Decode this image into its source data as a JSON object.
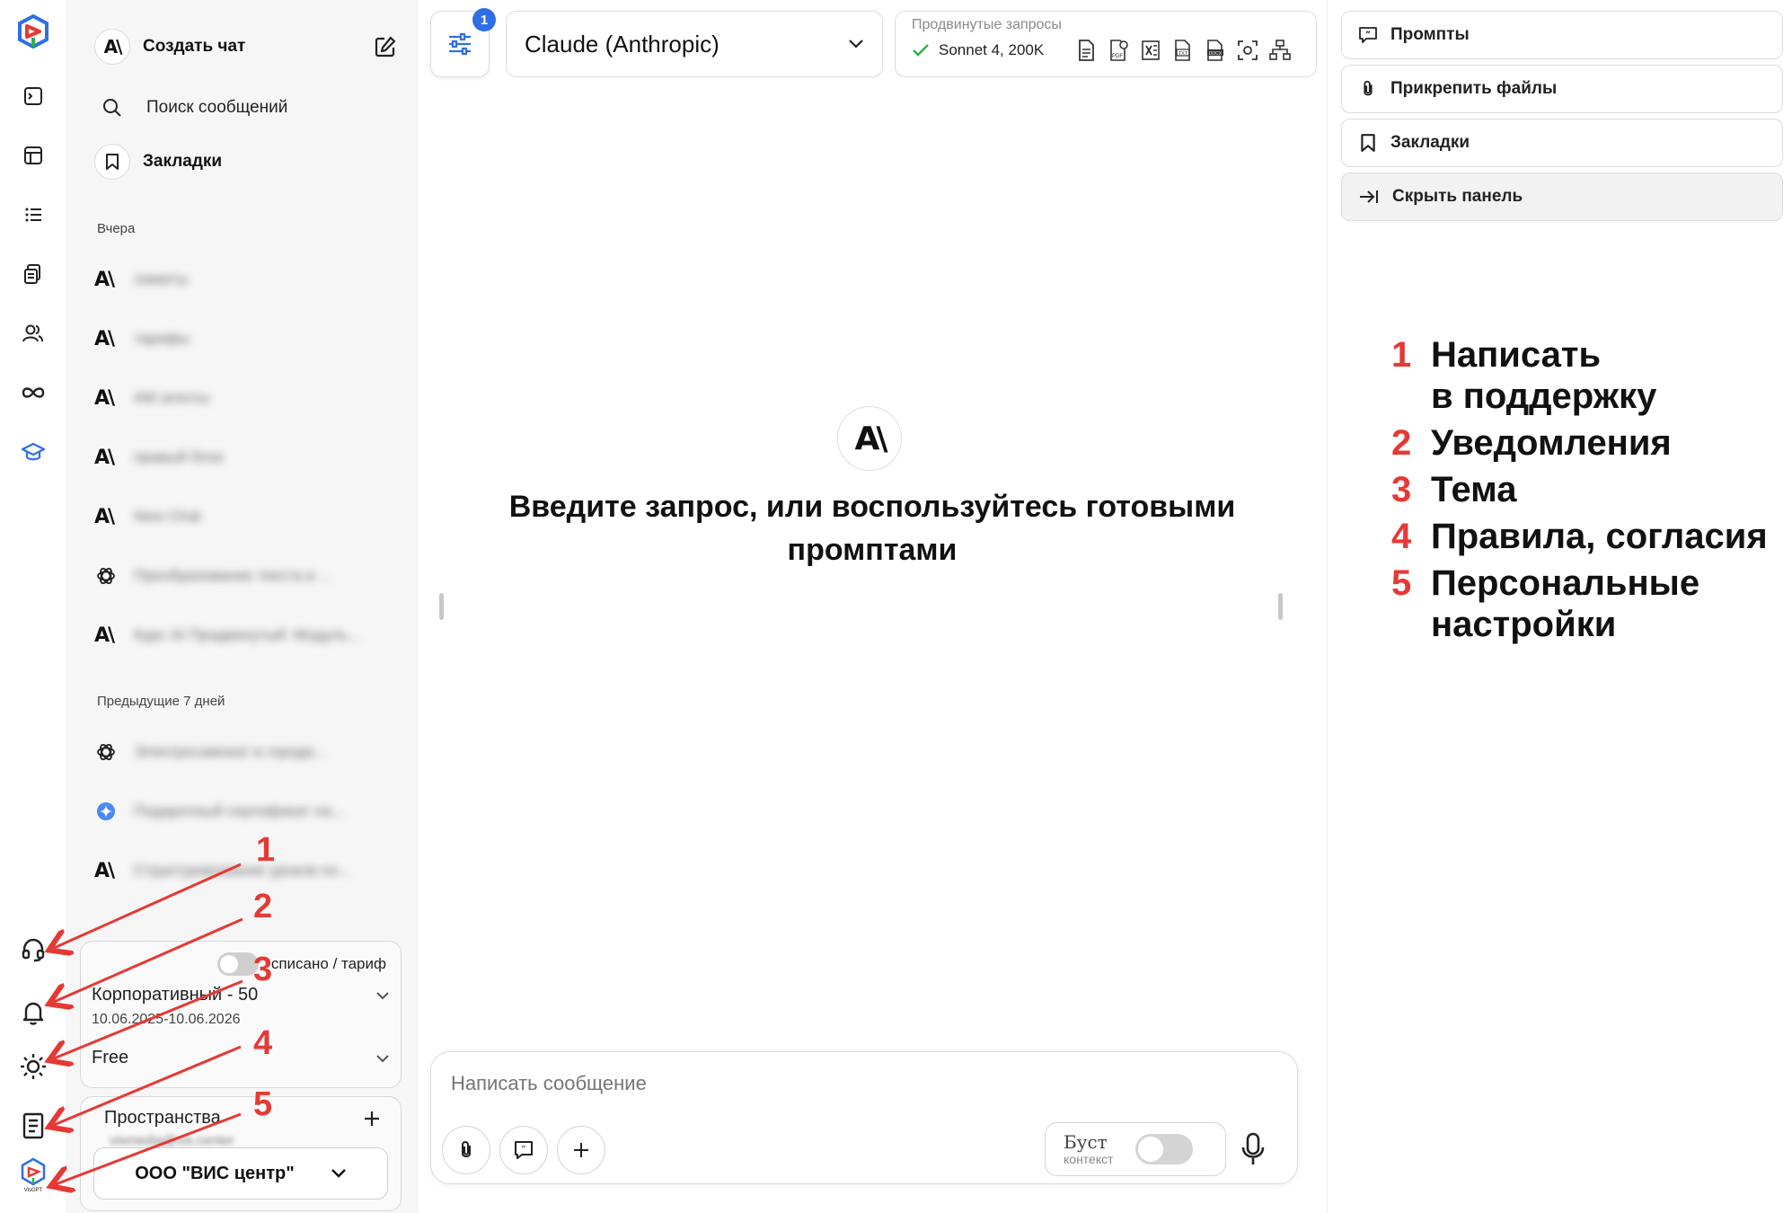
{
  "sidebar": {
    "new_chat_label": "Создать чат",
    "search_label": "Поиск сообщений",
    "bookmarks_label": "Закладки",
    "section_yesterday": "Вчера",
    "section_prev7": "Предыдущие 7 дней",
    "chats_yesterday": [
      {
        "icon": "anthropic-icon",
        "title": "лимиты"
      },
      {
        "icon": "anthropic-icon",
        "title": "тарифы"
      },
      {
        "icon": "anthropic-icon",
        "title": "AM агенты"
      },
      {
        "icon": "anthropic-icon",
        "title": "правый блок"
      },
      {
        "icon": "anthropic-icon",
        "title": "New Chat"
      },
      {
        "icon": "openai-icon",
        "title": "Преобразование текста в ..."
      },
      {
        "icon": "anthropic-icon",
        "title": "Курс AI Продвинутый: Модуль..."
      }
    ],
    "chats_prev7": [
      {
        "icon": "openai-icon",
        "title": "Электросамокат в городе..."
      },
      {
        "icon": "gemini-icon",
        "title": "Подарочный сертификат на..."
      },
      {
        "icon": "anthropic-icon",
        "title": "Структурирование уроков по..."
      }
    ],
    "billing_toggle_label": "списано / тариф",
    "tariff_name": "Корпоративный - 50",
    "tariff_dates": "10.06.2025-10.06.2026",
    "free_label": "Free",
    "spaces_label": "Пространства",
    "spaces_email": "vismedia@vis.center",
    "org_name": "ООО \"ВИС центр\""
  },
  "main": {
    "settings_badge": "1",
    "model_name": "Claude (Anthropic)",
    "advanced_label": "Продвинутые запросы",
    "advanced_model": "Sonnet 4, 200K",
    "hero_text": "Введите запрос, или воспользуйтесь готовыми промптами",
    "composer_placeholder": "Написать сообщение",
    "boost_title": "Буст",
    "boost_sub": "контекст"
  },
  "right_panel": {
    "buttons": [
      "Промпты",
      "Прикрепить файлы",
      "Закладки",
      "Скрыть панель"
    ]
  },
  "annotations": {
    "color": "#e53935",
    "items": [
      {
        "num": "1",
        "text": "Написать\nв поддержку"
      },
      {
        "num": "2",
        "text": "Уведомления"
      },
      {
        "num": "3",
        "text": "Тема"
      },
      {
        "num": "4",
        "text": "Правила, согласия"
      },
      {
        "num": "5",
        "text": "Персональные\nнастройки"
      }
    ]
  },
  "icons": {
    "rail_top": [
      "app-logo-icon",
      "terminal-icon",
      "table-icon",
      "list-icon",
      "documents-icon",
      "users-icon",
      "infinity-icon",
      "graduation-cap-icon"
    ],
    "rail_bottom": [
      "headset-icon",
      "bell-icon",
      "sun-icon",
      "rules-icon",
      "visgpt-logo-icon"
    ]
  },
  "colors": {
    "accent_blue": "#2f6ee6",
    "annotation_red": "#e53935",
    "sidebar_bg": "#f6f6f6"
  }
}
